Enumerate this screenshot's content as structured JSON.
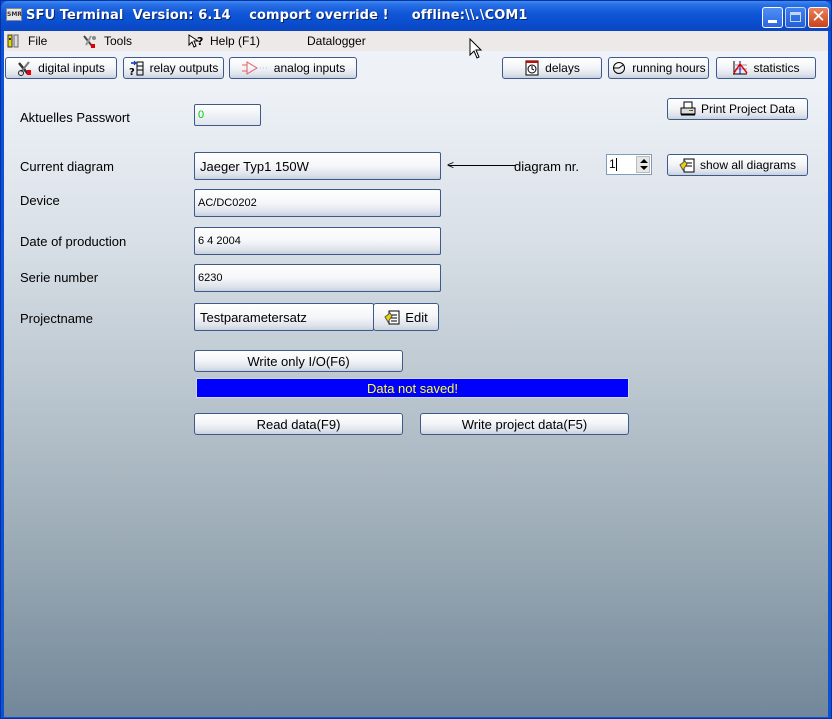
{
  "window": {
    "title": "SFU Terminal  Version: 6.14    comport override !     offline:\\\\.\\COM1",
    "app_icon_text": "SMR",
    "controls": {
      "minimize": "minimize",
      "maximize": "maximize",
      "close": "✕"
    }
  },
  "menubar": {
    "items": [
      {
        "label": "File",
        "icon": "file-icon"
      },
      {
        "label": "Tools",
        "icon": "tools-icon"
      },
      {
        "label": "Help (F1)",
        "icon": "help-icon"
      },
      {
        "label": "Datalogger"
      }
    ]
  },
  "toolbar": {
    "left": [
      {
        "label": "digital inputs",
        "icon": "digital-inputs-icon"
      },
      {
        "label": "relay outputs",
        "icon": "relay-outputs-icon"
      },
      {
        "label": "analog inputs",
        "icon": "analog-inputs-icon"
      }
    ],
    "right": [
      {
        "label": "delays",
        "icon": "clock-icon"
      },
      {
        "label": "running hours",
        "icon": "gauge-icon"
      },
      {
        "label": "statistics",
        "icon": "chart-icon"
      }
    ]
  },
  "form": {
    "password": {
      "label": "Aktuelles Passwort",
      "value": "0"
    },
    "print_button": "Print Project Data",
    "current_diagram": {
      "label": "Current diagram",
      "value": "Jaeger Typ1   150W"
    },
    "diagram_nr": {
      "label": "diagram nr.",
      "value": "1"
    },
    "show_all_button": "show all diagrams",
    "device": {
      "label": "Device",
      "value": "AC/DC0202"
    },
    "date_of_production": {
      "label": "Date of production",
      "value": "6 4 2004"
    },
    "serie_number": {
      "label": "Serie number",
      "value": "6230"
    },
    "projectname": {
      "label": "Projectname",
      "value": "Testparametersatz"
    },
    "edit_button": "Edit"
  },
  "actions": {
    "write_io": "Write only I/O(F6)",
    "status": "Data not saved!",
    "read_data": "Read data(F9)",
    "write_project": "Write project data(F5)"
  },
  "colors": {
    "status_bg": "#0000ff",
    "status_text": "#ffff33",
    "password_text": "#00cc00"
  }
}
